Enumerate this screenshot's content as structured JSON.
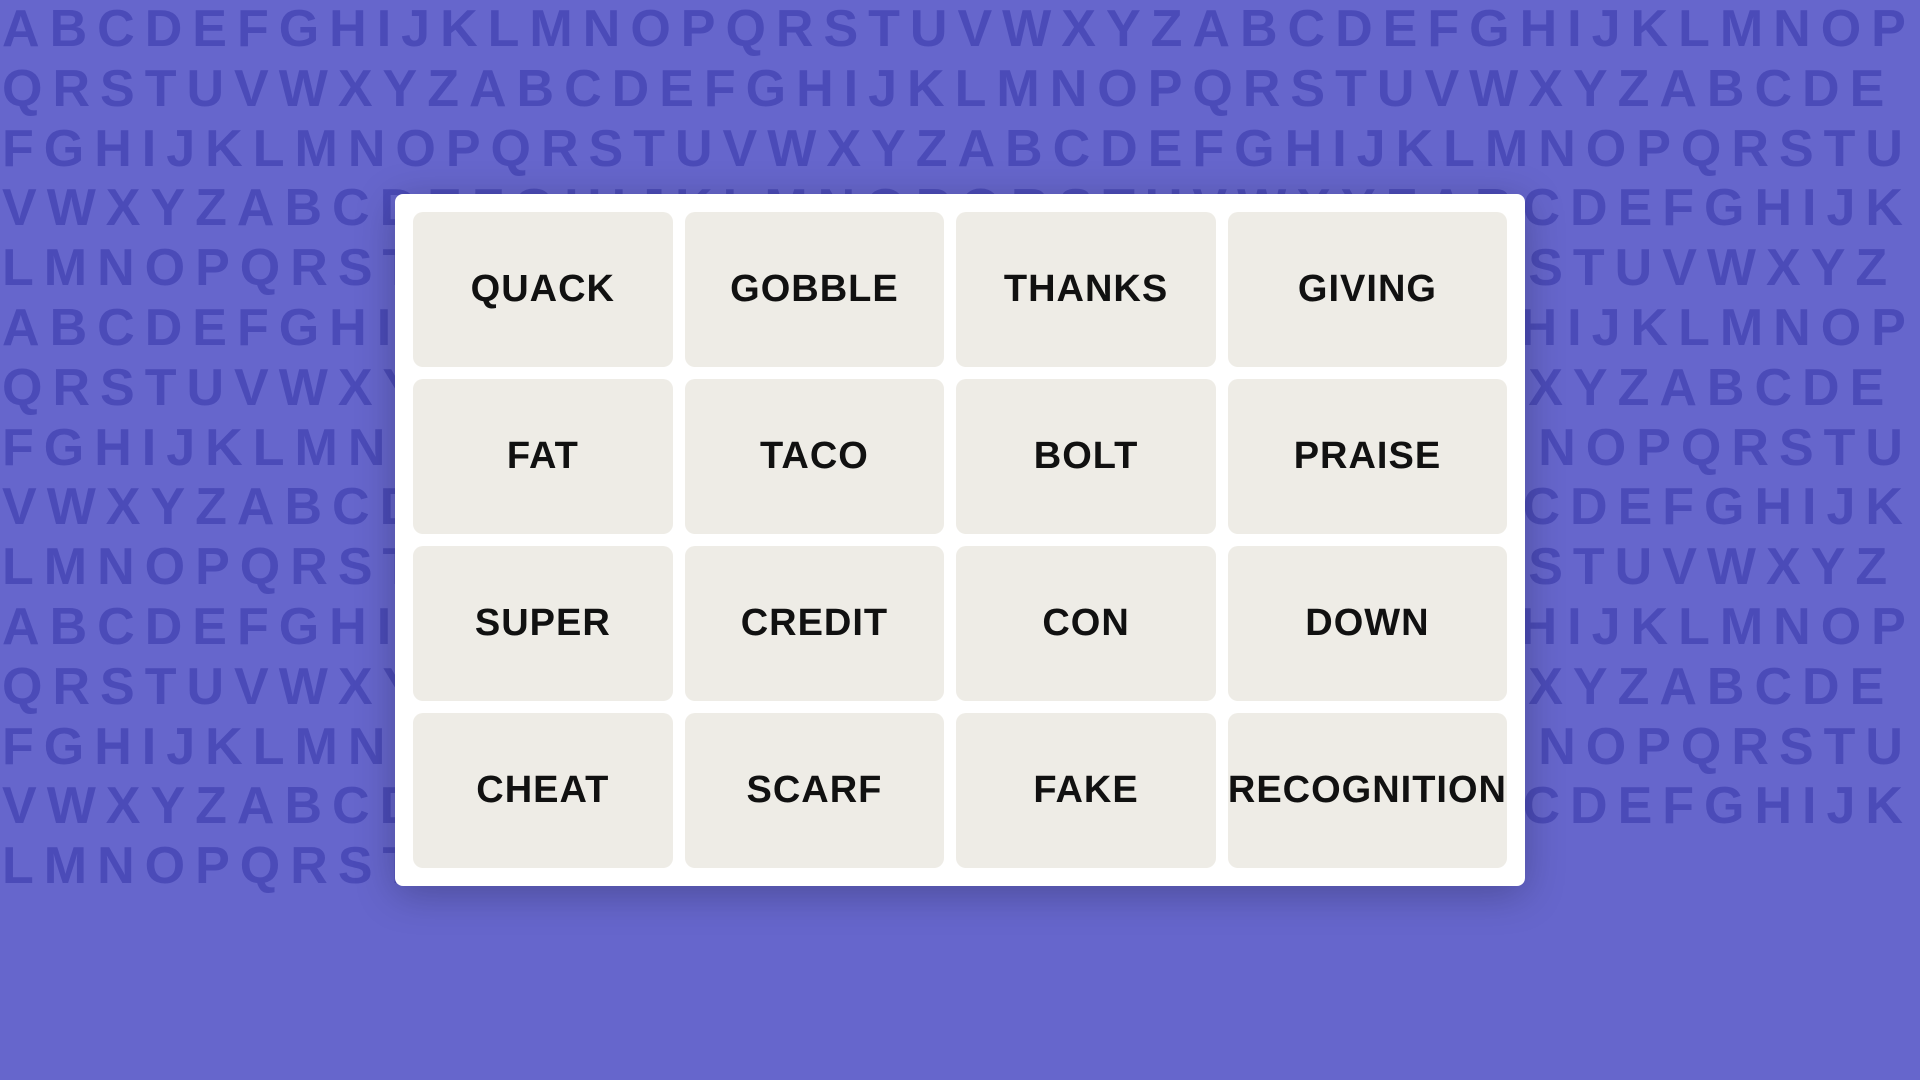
{
  "background": {
    "color": "#6666cc",
    "alphabet_text": "ABCDEFGHIJKLMNOPQRSTUVWXYZ"
  },
  "grid": {
    "words": [
      {
        "id": "quack",
        "label": "QUACK"
      },
      {
        "id": "gobble",
        "label": "GOBBLE"
      },
      {
        "id": "thanks",
        "label": "THANKS"
      },
      {
        "id": "giving",
        "label": "GIVING"
      },
      {
        "id": "fat",
        "label": "FAT"
      },
      {
        "id": "taco",
        "label": "TACO"
      },
      {
        "id": "bolt",
        "label": "BOLT"
      },
      {
        "id": "praise",
        "label": "PRAISE"
      },
      {
        "id": "super",
        "label": "SUPER"
      },
      {
        "id": "credit",
        "label": "CREDIT"
      },
      {
        "id": "con",
        "label": "CON"
      },
      {
        "id": "down",
        "label": "DOWN"
      },
      {
        "id": "cheat",
        "label": "CHEAT"
      },
      {
        "id": "scarf",
        "label": "SCARF"
      },
      {
        "id": "fake",
        "label": "FAKE"
      },
      {
        "id": "recognition",
        "label": "RECOGNITION"
      }
    ]
  }
}
